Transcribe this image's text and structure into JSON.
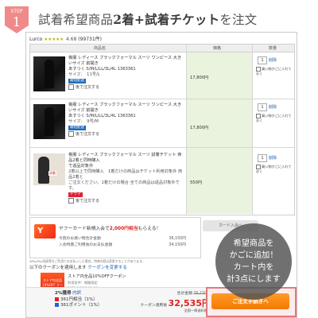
{
  "step": {
    "label": "STEP",
    "number": "1",
    "color": "#f08a8a"
  },
  "heading": {
    "pre": "試着希望商品",
    "hl1": "2着",
    "plus": "+",
    "hl2": "試着チケット",
    "post": "を注文"
  },
  "shop": {
    "name": "Lurco",
    "stars": "★★★★★",
    "score": "4.68",
    "reviews": "(99731件)"
  },
  "table": {
    "col_product": "商品名",
    "col_price": "価格",
    "col_qty": "数量"
  },
  "items": [
    {
      "line1": "喪服 レディース ブラックフォーマル スーツ ワンピース 大きいサイズ 前開き",
      "line2": "あすつく S/M/L/LL/3L/4L 1363361",
      "size": "サイズ：　11号/L",
      "badge": "最短配送",
      "price": "17,800円",
      "qty": "1",
      "delete": "削除",
      "fav": "買い物かごに入れておく",
      "later": "後で注文する"
    },
    {
      "line1": "喪服 レディース ブラックフォーマル スーツ ワンピース 大きいサイズ 前開き",
      "line2": "あすつく S/M/L/LL/3L/4L 1363361",
      "size": "サイズ：　9号/M",
      "badge": "最短配送",
      "price": "17,800円",
      "qty": "1",
      "delete": "削除",
      "fav": "買い物かごに入れておく",
      "later": "後で注文する"
    },
    {
      "line1": "喪服 レディース ブラックフォーマル スーツ 試着チケット 商品2着と同時購入",
      "line2": "で返品対象外",
      "desc1": "2着以上で同時購入　1着だけの商品はチケット利用対象外 商品2着と",
      "desc2": "ご注文ください。1着だけの場合 全ての商品は返品対象外です。",
      "thumb_label": "試着",
      "badge": "ドラマ",
      "price": "550円",
      "qty": "1",
      "delete": "削除",
      "fav": "買い物かごに入れておく",
      "later": "後で注文する"
    }
  ],
  "card": {
    "title_pre": "ヤフーカード新規入会で",
    "title_hl": "2,000円相当",
    "title_post": "もらえる！",
    "row1_label": "今回のお買い物合計金額",
    "row1_value": "36,150円",
    "row2_label": "入会特典ご利用後のお支払金額",
    "row2_value": "34,150円",
    "button": "カード入会へ",
    "logo": "Y"
  },
  "note": "※PayPay残高等をご利用でお支払いした場合。特典内容は変更することがあります。",
  "coupons": {
    "title": "以下のクーポンを適用します",
    "link": "クーポンを変更する",
    "name": "ストア内全品10%OFFクーポン",
    "detail": "利用条件：期間限定",
    "period": "2021/06/19 00:00まで"
  },
  "img_coupon": "ストア内全品\n10%OFF\nクーポン",
  "summary": {
    "rate": "2%獲得",
    "rate_link": "内訳",
    "pts1": "361円相当（1%）",
    "pts2": "361ポイント（1%）",
    "total_label": "合計金額",
    "total_old": "36,150円",
    "coupon_label": "クーポン適用後",
    "total_new": "32,535円",
    "shipping": "全国一律送料無料"
  },
  "order_button": "ご注文手続きへ",
  "bubble_lines": [
    "希望商品を",
    "かごに追加！",
    "カート内を",
    "計3点にします"
  ]
}
